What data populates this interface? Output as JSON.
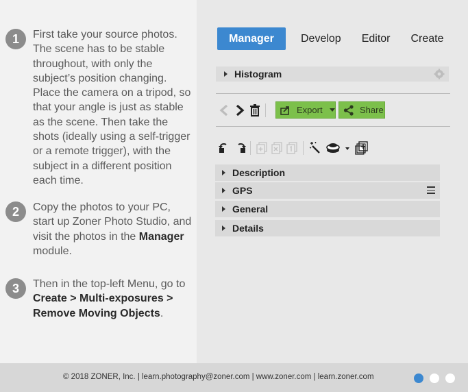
{
  "steps": [
    {
      "number": "1",
      "text": "First take your source photos. The scene has to be stable throughout, with only the subject’s position changing. Place the camera on a tripod, so that your angle is just as stable as the scene. Then take the shots (ideally using a self-trigger or a remote trigger), with the subject in a different position each time."
    },
    {
      "number": "2",
      "text_before": "Copy the photos to your PC, start up Zoner Photo Studio, and visit the photos in the ",
      "bold": "Manager",
      "text_after": " module."
    },
    {
      "number": "3",
      "text_before": "Then in the top-left Menu, go to ",
      "bold": "Create > Multi-exposures > Remove Moving Objects",
      "text_after": "."
    }
  ],
  "tabs": [
    "Manager",
    "Develop",
    "Editor",
    "Create"
  ],
  "active_tab": "Manager",
  "histogram_label": "Histogram",
  "toolbar": {
    "export_label": "Export",
    "share_label": "Share"
  },
  "sections": [
    "Description",
    "GPS",
    "General",
    "Details"
  ],
  "footer": {
    "text": "© 2018 ZONER, Inc.  |  learn.photography@zoner.com  |  www.zoner.com  |  learn.zoner.com"
  },
  "colors": {
    "accent": "#3c88d0",
    "green_button": "#7cc04b"
  }
}
